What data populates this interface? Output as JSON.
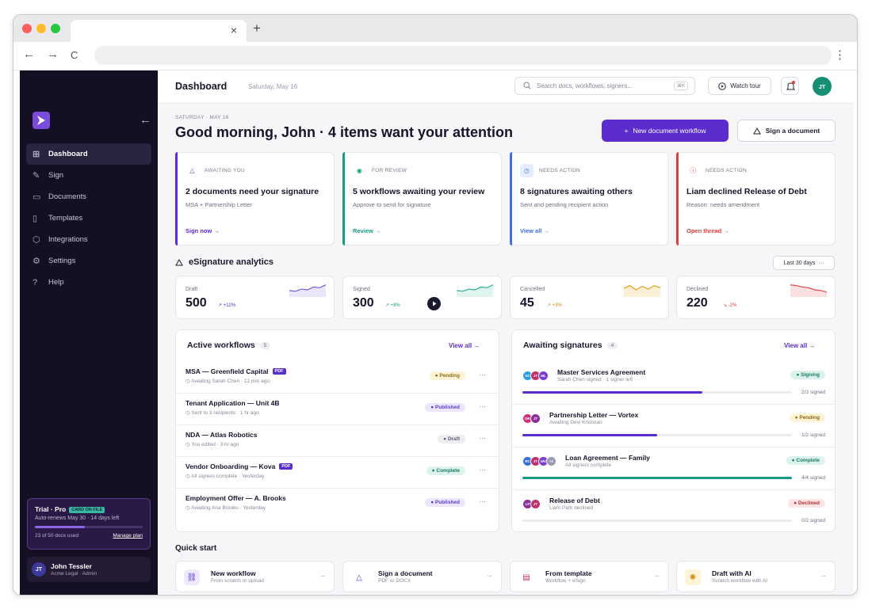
{
  "browser": {
    "tab_close": "×",
    "new_tab": "+",
    "back": "←",
    "forward": "→",
    "reload": "C",
    "menu": "⋮"
  },
  "sidebar": {
    "collapse_icon": "←",
    "items": [
      {
        "label": "Dashboard",
        "icon": "grid-icon",
        "glyph": "⊞"
      },
      {
        "label": "Sign",
        "icon": "pen-icon",
        "glyph": "✎"
      },
      {
        "label": "Documents",
        "icon": "folder-icon",
        "glyph": "▭"
      },
      {
        "label": "Templates",
        "icon": "file-icon",
        "glyph": "▯"
      },
      {
        "label": "Integrations",
        "icon": "cube-icon",
        "glyph": "⬡"
      },
      {
        "label": "Settings",
        "icon": "gear-icon",
        "glyph": "⚙"
      },
      {
        "label": "Help",
        "icon": "help-icon",
        "glyph": "?"
      }
    ],
    "trial": {
      "title": "Trial · Pro",
      "badge": "CARD ON FILE",
      "subtitle": "Auto-renews May 30 · 14 days left",
      "used": "23 of 50 docs used",
      "used_fraction": 0.46,
      "manage": "Manage plan"
    },
    "user": {
      "initials": "JT",
      "name": "John Tessler",
      "role": "Acme Legal · Admin"
    }
  },
  "header": {
    "title": "Dashboard",
    "date": "Saturday, May 16",
    "search_placeholder": "Search docs, workflows, signers...",
    "search_shortcut": "⌘K",
    "tour_label": "Watch tour",
    "avatar_initials": "JT"
  },
  "hero": {
    "eyebrow": "SATURDAY · MAY 16",
    "greeting": "Good morning, John · 4 items want your attention",
    "primary_label": "New document workflow",
    "primary_icon": "+",
    "secondary_label": "Sign a document"
  },
  "action_cards": [
    {
      "eyebrow": "AWAITING YOU",
      "title": "2 documents need your signature",
      "sub": "MSA + Partnership Letter",
      "link": "Sign now →",
      "color": "#5b2dcf"
    },
    {
      "eyebrow": "FOR REVIEW",
      "title": "5 workflows awaiting your review",
      "sub": "Approve to send for signature",
      "link": "Review →",
      "color": "#169a83"
    },
    {
      "eyebrow": "NEEDS ACTION",
      "title": "8 signatures awaiting others",
      "sub": "Sent and pending recipient action",
      "link": "View all →",
      "color": "#3f6fe0"
    },
    {
      "eyebrow": "NEEDS ACTION",
      "title": "Liam declined Release of Debt",
      "sub": "Reason: needs amendment",
      "link": "Open thread →",
      "color": "#e23b3b"
    }
  ],
  "analytics": {
    "title": "eSignature analytics",
    "range": "Last 30 days",
    "range_icon": "···",
    "stats": [
      {
        "label": "Draft",
        "value": "500",
        "delta": "↗ +12%",
        "delta_color": "#5b2dcf",
        "color": "#7b5be0",
        "fill": "#ece6fb"
      },
      {
        "label": "Signed",
        "value": "300",
        "delta": "↗ +8%",
        "delta_color": "#169a83",
        "color": "#2cae93",
        "fill": "#e0f4ef"
      },
      {
        "label": "Cancelled",
        "value": "45",
        "delta": "↗ +3%",
        "delta_color": "#c98a12",
        "color": "#e2a21e",
        "fill": "#fbf0d6"
      },
      {
        "label": "Declined",
        "value": "220",
        "delta": "↘ -2%",
        "delta_color": "#e23b3b",
        "color": "#e44848",
        "fill": "#fbe0e0"
      }
    ]
  },
  "workflows": {
    "title": "Active workflows",
    "count": "5",
    "view_all": "View all →",
    "rows": [
      {
        "name": "MSA — Greenfield Capital",
        "pdf": "PDF",
        "meta": "◷ Awaiting Sarah Chen · 12 min ago",
        "status": "● Pending",
        "status_class": "st-pending"
      },
      {
        "name": "Tenant Application — Unit 4B",
        "pdf": "",
        "meta": "◷ Sent to 3 recipients · 1 hr ago",
        "status": "● Published",
        "status_class": "st-published"
      },
      {
        "name": "NDA — Atlas Robotics",
        "pdf": "",
        "meta": "◷ You edited · 3 hr ago",
        "status": "● Draft",
        "status_class": "st-draft"
      },
      {
        "name": "Vendor Onboarding — Kova",
        "pdf": "PDF",
        "meta": "◷ All signers complete · Yesterday",
        "status": "● Complete",
        "status_class": "st-complete"
      },
      {
        "name": "Employment Offer — A. Brooks",
        "pdf": "",
        "meta": "◷ Awaiting Ana Brooks · Yesterday",
        "status": "● Published",
        "status_class": "st-published"
      }
    ],
    "more": "···"
  },
  "signatures": {
    "title": "Awaiting signatures",
    "count": "4",
    "view_all": "View all →",
    "rows": [
      {
        "name": "Master Services Agreement",
        "meta": "Sarah Chen signed · 1 signer left",
        "status": "● Signing",
        "status_class": "st-signing",
        "progress": 0.667,
        "bar_color": "#5b2dcf",
        "frac": "2/3 signed",
        "avatars": [
          {
            "t": "SC",
            "c": "#2b9de0"
          },
          {
            "t": "JT",
            "c": "#c0306a"
          },
          {
            "t": "ML",
            "c": "#7b3fcf"
          }
        ]
      },
      {
        "name": "Partnership Letter — Vortex",
        "meta": "Awaiting Devi Krishnan",
        "status": "● Pending",
        "status_class": "st-pending",
        "progress": 0.5,
        "bar_color": "#5b2dcf",
        "frac": "1/2 signed",
        "avatars": [
          {
            "t": "DK",
            "c": "#d0307a"
          },
          {
            "t": "JT",
            "c": "#8a2f9c"
          }
        ]
      },
      {
        "name": "Loan Agreement — Family",
        "meta": "All signers complete",
        "status": "● Complete",
        "status_class": "st-complete",
        "progress": 1.0,
        "bar_color": "#169a83",
        "frac": "4/4 signed",
        "avatars": [
          {
            "t": "RC",
            "c": "#3b6fd8"
          },
          {
            "t": "JT",
            "c": "#c0306a"
          },
          {
            "t": "MV",
            "c": "#7b3fcf"
          },
          {
            "t": "+1",
            "c": "#9a9aae"
          }
        ]
      },
      {
        "name": "Release of Debt",
        "meta": "Liam Park declined",
        "status": "● Declined",
        "status_class": "st-declined",
        "progress": 0.0,
        "bar_color": "#e23b3b",
        "frac": "0/2 signed",
        "avatars": [
          {
            "t": "LP",
            "c": "#8a2f9c"
          },
          {
            "t": "JT",
            "c": "#c0306a"
          }
        ]
      }
    ]
  },
  "quick_start": {
    "title": "Quick start",
    "arrow": "→",
    "items": [
      {
        "name": "New workflow",
        "sub": "From scratch or upload",
        "icon": "workflow-icon",
        "bg": "#efe9ff",
        "color": "#5b2dcf"
      },
      {
        "name": "Sign a document",
        "sub": "PDF or DOCX",
        "icon": "signature-icon",
        "bg": "#ffffff",
        "color": "#5b2dcf"
      },
      {
        "name": "From template",
        "sub": "Workflow + eSign",
        "icon": "template-icon",
        "bg": "#ffffff",
        "color": "#c0306a"
      },
      {
        "name": "Draft with AI",
        "sub": "Scratch workflow with AI",
        "icon": "sparkle-icon",
        "bg": "#fff3d6",
        "color": "#c98a12"
      }
    ]
  },
  "trend_shapes": {
    "up": [
      0.55,
      0.6,
      0.45,
      0.5,
      0.3,
      0.35,
      0.15
    ],
    "wave": [
      0.4,
      0.2,
      0.5,
      0.25,
      0.45,
      0.2,
      0.35
    ],
    "down": [
      0.15,
      0.2,
      0.3,
      0.35,
      0.5,
      0.55,
      0.65
    ]
  }
}
